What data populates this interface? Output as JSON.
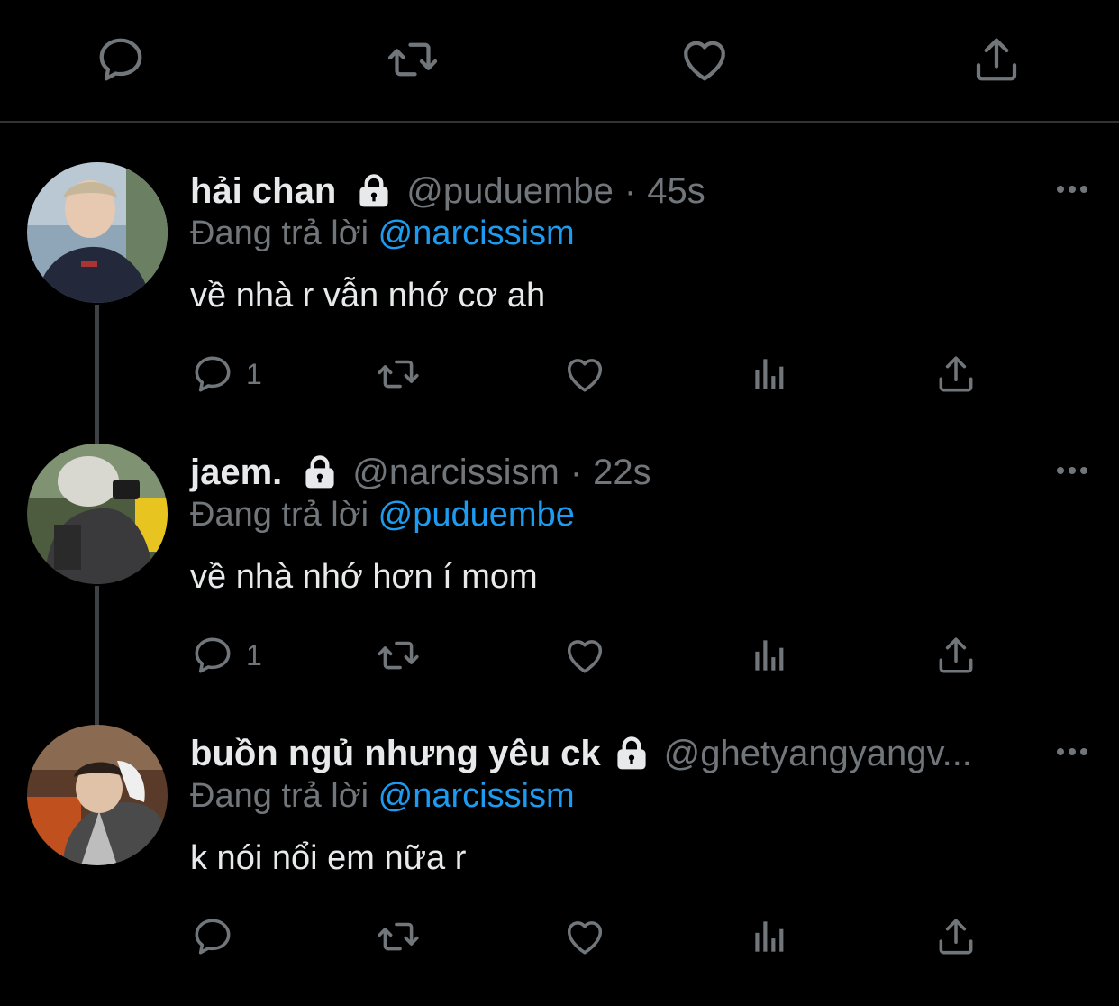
{
  "top_actions": {
    "icons": [
      "reply-icon",
      "retweet-icon",
      "like-icon",
      "share-icon"
    ]
  },
  "colors": {
    "background": "#000000",
    "text_primary": "#e7e9ea",
    "text_secondary": "#71767b",
    "accent": "#1d9bf0",
    "divider": "#2f3336"
  },
  "replying_prefix": "Đang trả lời",
  "tweets": [
    {
      "name": "hải chan",
      "handle": "@puduembe",
      "separator": "·",
      "time": "45s",
      "reply_to": "@narcissism",
      "text": "về nhà r vẫn nhớ cơ ah",
      "reply_count": "1",
      "protected": true
    },
    {
      "name": "jaem.",
      "handle": "@narcissism",
      "separator": "·",
      "time": "22s",
      "reply_to": "@puduembe",
      "text": "về nhà nhớ hơn í mom",
      "reply_count": "1",
      "protected": true
    },
    {
      "name": "buồn ngủ nhưng yêu ck",
      "handle": "@ghetyangyangv...",
      "separator": "",
      "time": "",
      "reply_to": "@narcissism",
      "text": "k nói nổi em nữa r",
      "reply_count": "",
      "protected": true
    }
  ]
}
